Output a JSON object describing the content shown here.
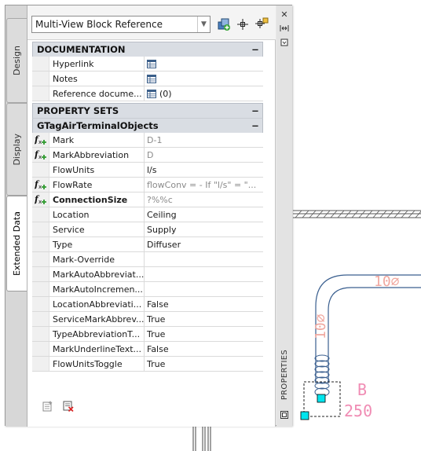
{
  "palette": {
    "object_type": "Multi-View Block Reference",
    "side_tabs": [
      "Design",
      "Display",
      "Extended Data"
    ],
    "active_tab": "Extended Data",
    "strip_title": "PROPERTIES",
    "sections": {
      "documentation": {
        "title": "DOCUMENTATION",
        "toggle": "−",
        "rows": [
          {
            "name": "Hyperlink",
            "value": ""
          },
          {
            "name": "Notes",
            "value": ""
          },
          {
            "name": "Reference docume...",
            "value": "(0)"
          }
        ]
      },
      "property_sets": {
        "title": "PROPERTY SETS",
        "toggle": "−"
      },
      "tag_set": {
        "title": "GTagAirTerminalObjects",
        "toggle": "−",
        "rows": [
          {
            "name": "Mark",
            "value": "D-1",
            "icon": "formula-icon"
          },
          {
            "name": "MarkAbbreviation",
            "value": "D",
            "icon": "formula-icon"
          },
          {
            "name": "FlowUnits",
            "value": "l/s"
          },
          {
            "name": "FlowRate",
            "value": "flowConv = - If \"l/s\" = \"...",
            "icon": "formula-icon"
          },
          {
            "name": "ConnectionSize",
            "value": "?%%c",
            "icon": "formula-icon"
          },
          {
            "name": "Location",
            "value": "Ceiling"
          },
          {
            "name": "Service",
            "value": "Supply"
          },
          {
            "name": "Type",
            "value": "Diffuser"
          },
          {
            "name": "Mark-Override",
            "value": ""
          },
          {
            "name": "MarkAutoAbbreviat...",
            "value": ""
          },
          {
            "name": "MarkAutoIncremen...",
            "value": ""
          },
          {
            "name": "LocationAbbreviati...",
            "value": "False"
          },
          {
            "name": "ServiceMarkAbbrev...",
            "value": "True"
          },
          {
            "name": "TypeAbbreviationT...",
            "value": "True"
          },
          {
            "name": "MarkUnderlineText...",
            "value": "False"
          },
          {
            "name": "FlowUnitsToggle",
            "value": "True"
          }
        ]
      }
    }
  },
  "drawing": {
    "duct_size": "10⌀",
    "mark_letter": "B",
    "flow_value": "250",
    "colors": {
      "duct": "#3a5f8f",
      "text": "#f0a8a0",
      "tag": "#f08cb4",
      "grip": "#00e5ee"
    }
  }
}
